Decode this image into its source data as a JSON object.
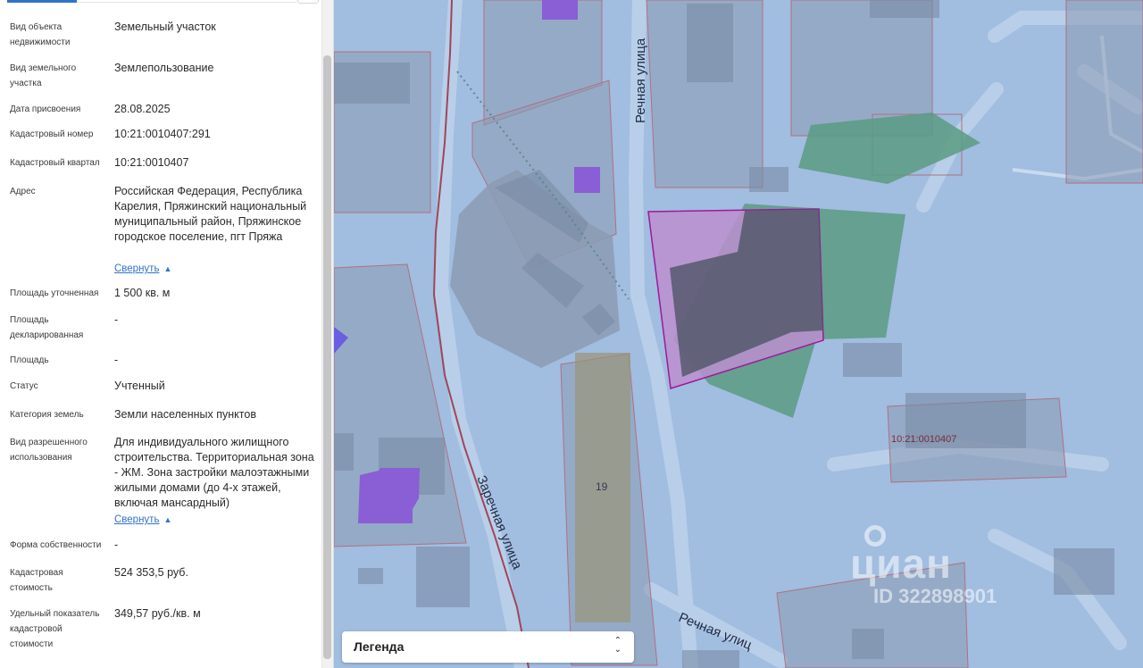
{
  "info": {
    "rows": [
      {
        "label": "Вид объекта недвижимости",
        "value": "Земельный участок"
      },
      {
        "label": "Вид земельного участка",
        "value": "Землепользование"
      },
      {
        "label": "Дата присвоения",
        "value": "28.08.2025"
      },
      {
        "label": "Кадастровый номер",
        "value": "10:21:0010407:291"
      },
      {
        "label": "Кадастровый квартал",
        "value": "10:21:0010407"
      },
      {
        "label": "Адрес",
        "value": "Российская Федерация, Республика Карелия, Пряжинский национальный муниципальный район, Пряжинское городское поселение, пгт Пряжа"
      },
      {
        "label": "Площадь уточненная",
        "value": "1 500 кв. м"
      },
      {
        "label": "Площадь декларированная",
        "value": "-"
      },
      {
        "label": "Площадь",
        "value": "-"
      },
      {
        "label": "Статус",
        "value": "Учтенный"
      },
      {
        "label": "Категория земель",
        "value": "Земли населенных пунктов"
      },
      {
        "label": "Вид разрешенного использования",
        "value": "Для индивидуального жилищного строительства. Территориальная зона - ЖМ. Зона застройки малоэтажными жилыми домами (до 4-х этажей, включая мансардный)"
      },
      {
        "label": "Форма собственности",
        "value": "-"
      },
      {
        "label": "Кадастровая стоимость",
        "value": "524 353,5 руб."
      },
      {
        "label": "Удельный показатель кадастровой стоимости",
        "value": "349,57 руб./кв. м"
      }
    ],
    "collapse_label": "Свернуть"
  },
  "map": {
    "street_rechnaya_top": "Речная улица",
    "street_zarechnaya": "Заречная улица",
    "street_rechnaya_bottom": "Речная улиц",
    "parcel_number": "19",
    "quarter_label": "10:21:0010407",
    "legend_label": "Легенда",
    "watermark_brand": "циан",
    "watermark_id": "ID 322898901",
    "colors": {
      "water": "#a1bde0",
      "road": "#b8cee8",
      "parcel_fill": "#8c9bb3",
      "selected_outline": "#a0189a",
      "selected_fill": "#bb8fce",
      "building": "#4f5566",
      "green": "#5a9b83",
      "violet": "#8a5ed4",
      "river_line": "#a0465a"
    }
  }
}
